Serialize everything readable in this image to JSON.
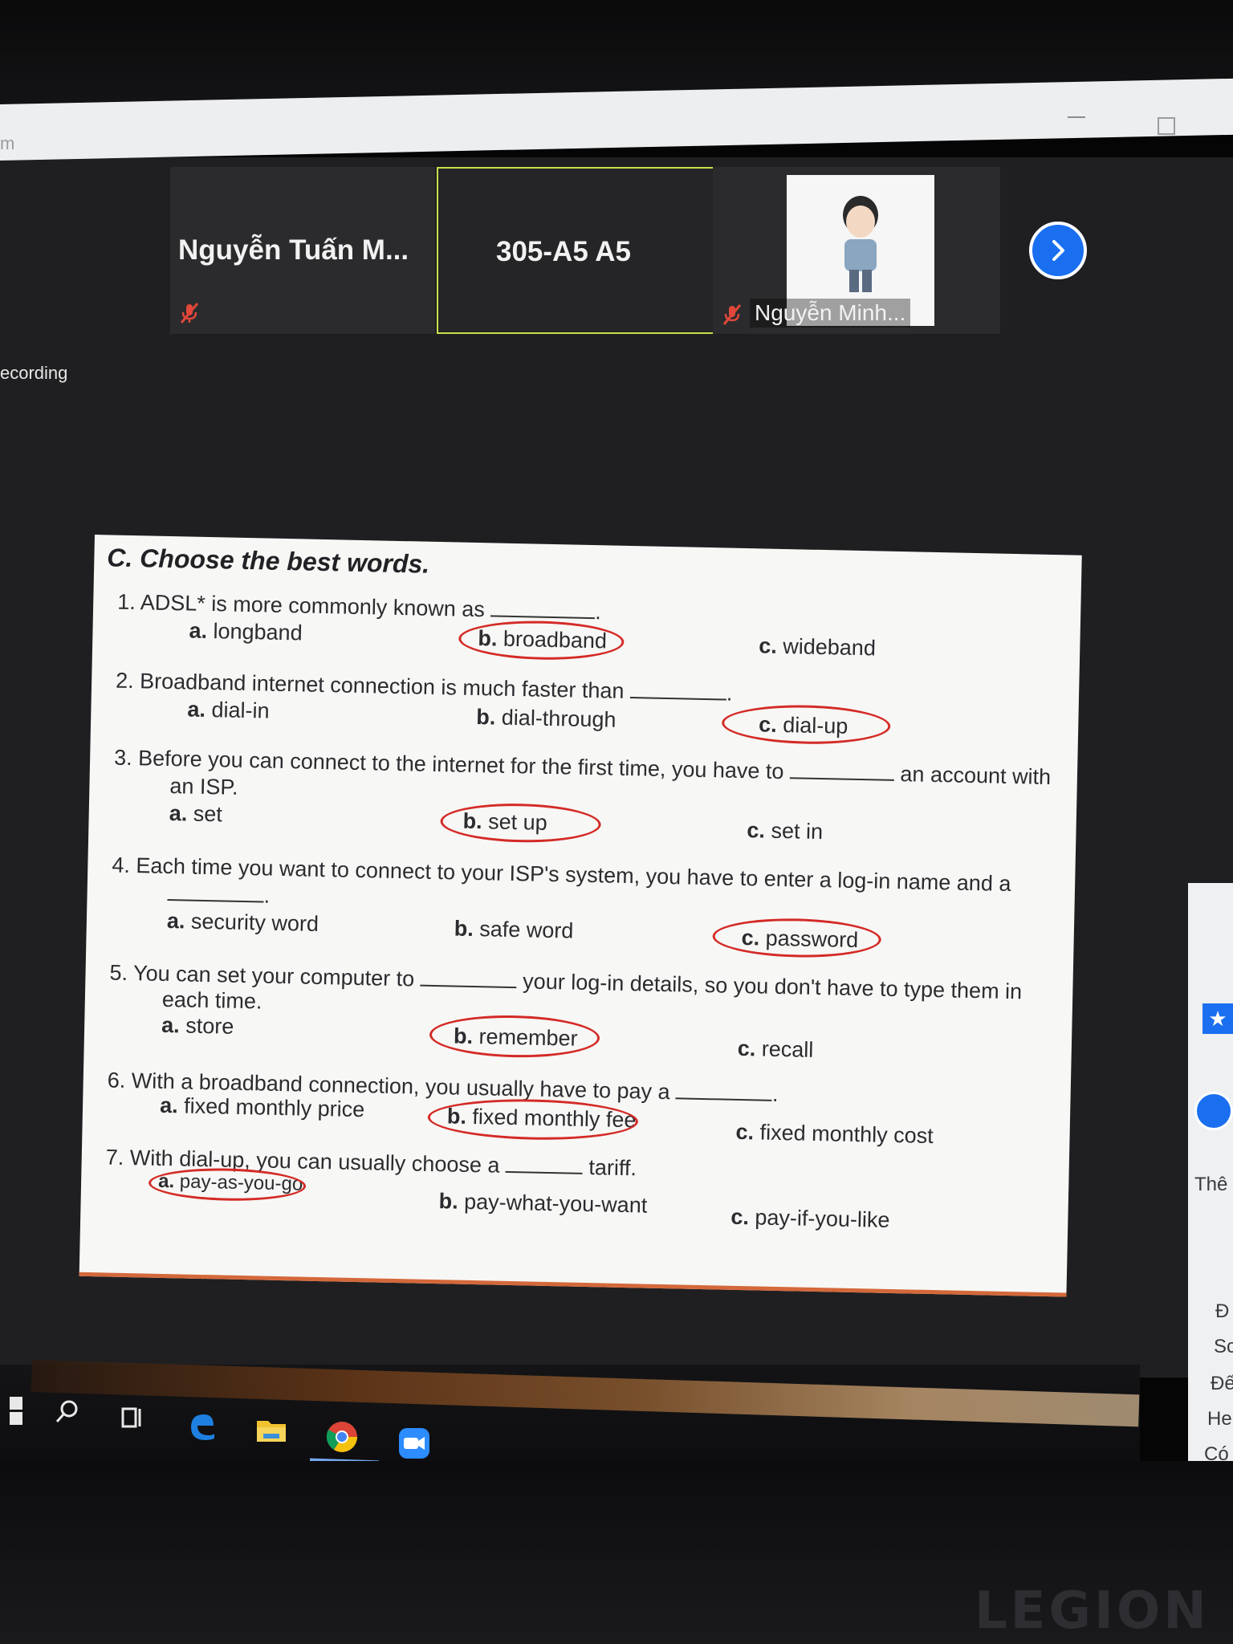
{
  "window": {
    "title_fragment": "m",
    "recording_label": "ecording"
  },
  "participants": [
    {
      "name": "Nguyễn Tuấn M...",
      "muted": true
    },
    {
      "name": "305-A5 A5",
      "active_speaker": true
    },
    {
      "name": "Nguyễn Minh...",
      "muted": true
    }
  ],
  "worksheet": {
    "title": "C. Choose the best words.",
    "questions": [
      {
        "stem_before": "1. ADSL* is more commonly known as",
        "stem_after": ".",
        "options": [
          "longband",
          "broadband",
          "wideband"
        ],
        "circled": 1
      },
      {
        "stem_before": "2. Broadband internet connection is much faster than",
        "stem_after": ".",
        "options": [
          "dial-in",
          "dial-through",
          "dial-up"
        ],
        "circled": 2
      },
      {
        "stem_before": "3. Before you can connect to the internet for the first time, you have to",
        "stem_after": "an account with",
        "stem_line2": "an ISP.",
        "options": [
          "set",
          "set up",
          "set in"
        ],
        "circled": 1
      },
      {
        "stem_before": "4. Each time you want to connect to your ISP's system, you have to enter a log-in name and a",
        "stem_after": ".",
        "options": [
          "security word",
          "safe word",
          "password"
        ],
        "circled": 2
      },
      {
        "stem_before": "5. You can set your computer to",
        "stem_after": "your log-in details, so you don't have to type them in",
        "stem_line2": "each time.",
        "options": [
          "store",
          "remember",
          "recall"
        ],
        "circled": 1
      },
      {
        "stem_before": "6. With a broadband connection, you usually have to pay a",
        "stem_after": ".",
        "options": [
          "fixed monthly price",
          "fixed monthly fee",
          "fixed monthly cost"
        ],
        "circled": 1
      },
      {
        "stem_before": "7. With dial-up, you can usually choose a",
        "stem_after": "tariff.",
        "options": [
          "pay-as-you-go",
          "pay-what-you-want",
          "pay-if-you-like"
        ],
        "circled": 0
      }
    ],
    "option_letters": [
      "a.",
      "b.",
      "c."
    ]
  },
  "side_panel": {
    "labels": [
      "Thê",
      "Đ",
      "Sc",
      "Đế",
      "He",
      "Có"
    ]
  },
  "brand": "LEGION",
  "colors": {
    "zoom_blue": "#1a6ff0",
    "active_speaker_border": "#c9e04a",
    "mute_red": "#e0473a",
    "answer_circle": "#d42a26",
    "worksheet_rule": "#d4683a"
  },
  "icons": [
    "windows-start-icon",
    "search-icon",
    "task-view-icon",
    "edge-icon",
    "file-explorer-icon",
    "chrome-icon",
    "zoom-icon"
  ]
}
